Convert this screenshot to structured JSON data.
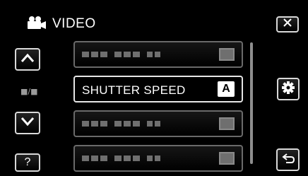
{
  "header": {
    "icon": "video-camera-icon",
    "title": "VIDEO"
  },
  "buttons": {
    "close_icon": "close-icon",
    "up_icon": "chevron-up-icon",
    "down_icon": "chevron-down-icon",
    "help_label": "?",
    "settings_icon": "gear-icon",
    "back_icon": "back-arrow-icon"
  },
  "page_indicator": "■/■",
  "menu": {
    "active_item": {
      "label": "SHUTTER SPEED",
      "value_badge": "A"
    }
  }
}
